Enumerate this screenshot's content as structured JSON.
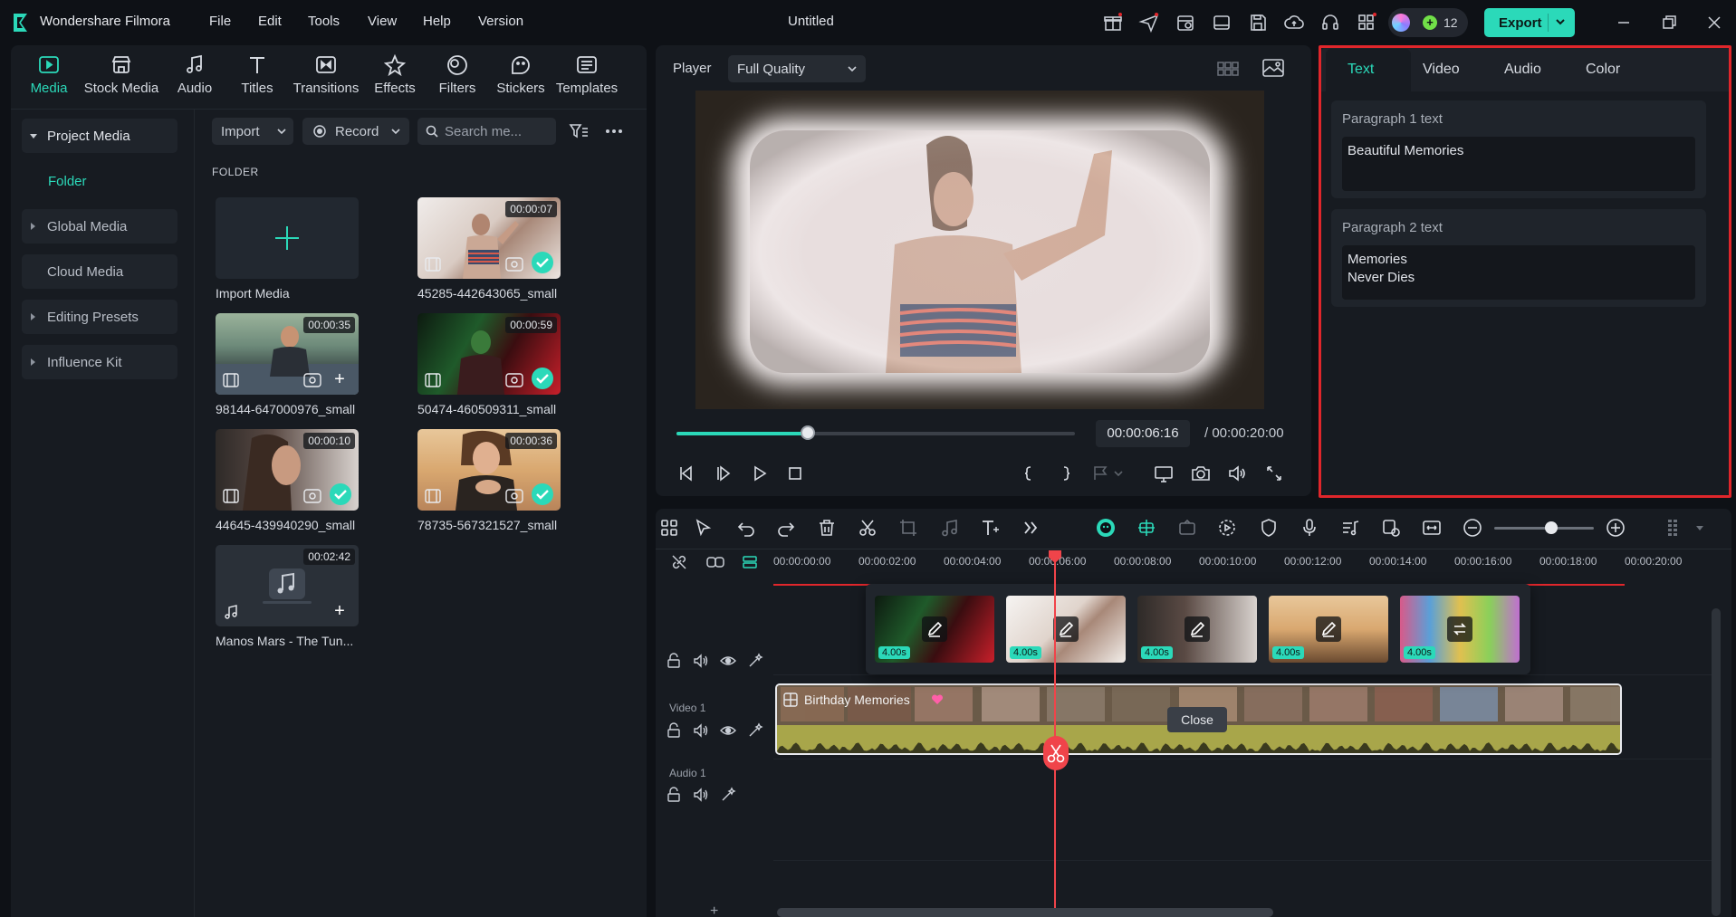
{
  "app": {
    "name": "Wondershare Filmora",
    "document_title": "Untitled",
    "menu": [
      "File",
      "Edit",
      "Tools",
      "View",
      "Help",
      "Version"
    ],
    "credits": "12",
    "export_label": "Export"
  },
  "media_tabs": [
    "Media",
    "Stock Media",
    "Audio",
    "Titles",
    "Transitions",
    "Effects",
    "Filters",
    "Stickers",
    "Templates"
  ],
  "sidebar": {
    "project_media": "Project Media",
    "folder": "Folder",
    "items": [
      "Global Media",
      "Cloud Media",
      "Editing Presets",
      "Influence Kit"
    ]
  },
  "media_toolbar": {
    "import": "Import",
    "record": "Record",
    "search_placeholder": "Search me..."
  },
  "folder_label": "FOLDER",
  "media": [
    {
      "name": "Import Media"
    },
    {
      "name": "45285-442643065_small",
      "duration": "00:00:07"
    },
    {
      "name": "98144-647000976_small",
      "duration": "00:00:35"
    },
    {
      "name": "50474-460509311_small",
      "duration": "00:00:59"
    },
    {
      "name": "44645-439940290_small",
      "duration": "00:00:10"
    },
    {
      "name": "78735-567321527_small",
      "duration": "00:00:36"
    },
    {
      "name": "Manos Mars - The Tun...",
      "duration": "00:02:42"
    }
  ],
  "player": {
    "label": "Player",
    "quality": "Full Quality",
    "current_time": "00:00:06:16",
    "total_time": "/ 00:00:20:00",
    "progress": 0.33
  },
  "properties": {
    "tabs": [
      "Text",
      "Video",
      "Audio",
      "Color"
    ],
    "paragraph1_label": "Paragraph 1 text",
    "paragraph1_value": "Beautiful Memories",
    "paragraph2_label": "Paragraph 2 text",
    "paragraph2_value": "Memories\nNever Dies"
  },
  "timeline": {
    "ruler": [
      "00:00:00:00",
      "00:00:02:00",
      "00:00:04:00",
      "00:00:06:00",
      "00:00:08:00",
      "00:00:10:00",
      "00:00:12:00",
      "00:00:14:00",
      "00:00:16:00",
      "00:00:18:00",
      "00:00:20:00"
    ],
    "tracks": {
      "video": "Video 1",
      "audio": "Audio 1"
    },
    "clip_title": "Birthday Memories",
    "popup_durations": [
      "4.00s",
      "4.00s",
      "4.00s",
      "4.00s",
      "4.00s"
    ],
    "close_tip": "Close"
  },
  "colors": {
    "accent": "#2bd9b9",
    "highlight": "#e0262b",
    "playhead": "#f0444a"
  }
}
